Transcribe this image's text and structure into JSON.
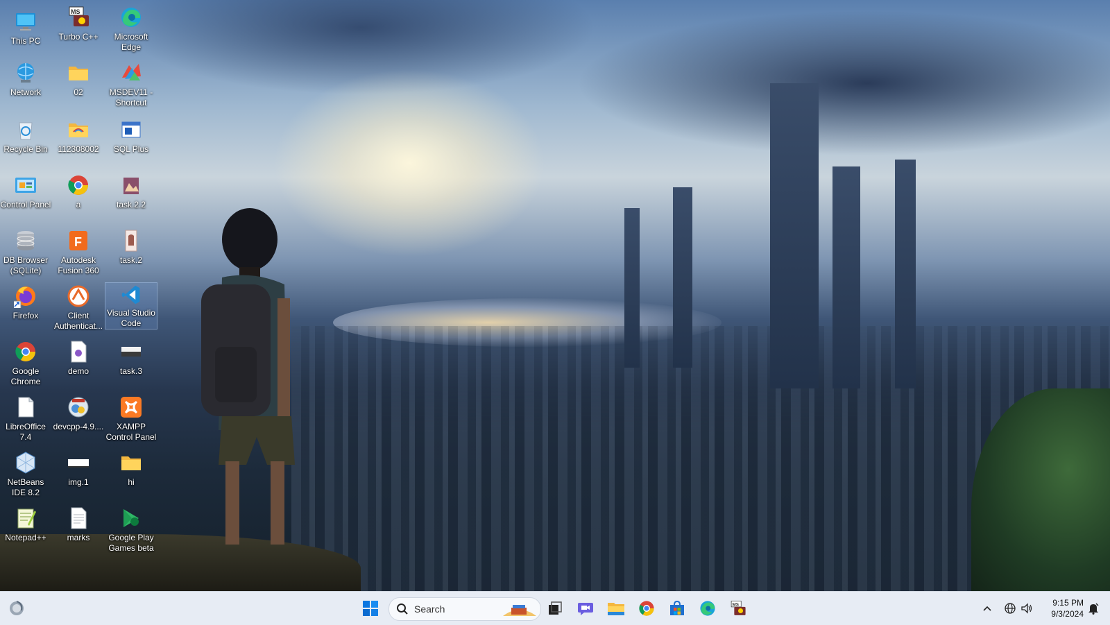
{
  "desktop": {
    "icons": [
      {
        "label": "This PC",
        "icon": "this-pc-icon"
      },
      {
        "label": "Turbo C++",
        "icon": "turbo-cpp-icon"
      },
      {
        "label": "Microsoft Edge",
        "icon": "edge-icon"
      },
      {
        "label": "Network",
        "icon": "network-icon"
      },
      {
        "label": "02",
        "icon": "folder-icon"
      },
      {
        "label": "MSDEV11 - Shortcut",
        "icon": "msdev-icon"
      },
      {
        "label": "Recycle Bin",
        "icon": "recycle-bin-icon"
      },
      {
        "label": "112308002",
        "icon": "folder-icon"
      },
      {
        "label": "SQL Plus",
        "icon": "sql-plus-icon"
      },
      {
        "label": "Control Panel",
        "icon": "control-panel-icon"
      },
      {
        "label": "a",
        "icon": "chrome-icon"
      },
      {
        "label": "task.2.2",
        "icon": "image-file-icon"
      },
      {
        "label": "DB Browser (SQLite)",
        "icon": "db-browser-icon"
      },
      {
        "label": "Autodesk Fusion 360",
        "icon": "fusion-360-icon"
      },
      {
        "label": "task.2",
        "icon": "image-file-icon"
      },
      {
        "label": "Firefox",
        "icon": "firefox-icon"
      },
      {
        "label": "Client Authenticat...",
        "icon": "client-auth-icon"
      },
      {
        "label": "Visual Studio Code",
        "icon": "vscode-icon"
      },
      {
        "label": "Google Chrome",
        "icon": "chrome-icon"
      },
      {
        "label": "demo",
        "icon": "document-icon"
      },
      {
        "label": "task.3",
        "icon": "image-file-icon"
      },
      {
        "label": "LibreOffice 7.4",
        "icon": "libreoffice-icon"
      },
      {
        "label": "devcpp-4.9....",
        "icon": "devcpp-installer-icon"
      },
      {
        "label": "XAMPP Control Panel",
        "icon": "xampp-icon"
      },
      {
        "label": "NetBeans IDE 8.2",
        "icon": "netbeans-icon"
      },
      {
        "label": "img.1",
        "icon": "image-file-icon"
      },
      {
        "label": "hi",
        "icon": "folder-icon"
      },
      {
        "label": "Notepad++",
        "icon": "notepadpp-icon"
      },
      {
        "label": "marks",
        "icon": "text-file-icon"
      },
      {
        "label": "Google Play Games beta",
        "icon": "google-play-games-icon"
      }
    ]
  },
  "taskbar": {
    "search_label": "Search",
    "apps": [
      "start-icon",
      "task-view-icon",
      "meet-icon",
      "file-explorer-icon",
      "chrome-icon",
      "microsoft-store-icon",
      "edge-icon",
      "turbo-cpp-icon"
    ],
    "clock": {
      "time": "9:15 PM",
      "date": "9/3/2024"
    }
  },
  "colors": {
    "taskbar_bg": "#e7ecf4",
    "accent": "#0067c0"
  }
}
